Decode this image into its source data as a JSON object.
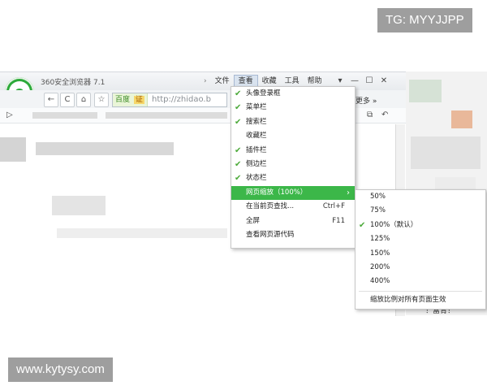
{
  "watermarks": {
    "top_right": "TG: MYYJJPP",
    "bottom_left": "www.kytysy.com"
  },
  "window": {
    "title": "360安全浏览器 7.1",
    "menu": {
      "arrow": "›",
      "items": [
        "文件",
        "查看",
        "收藏",
        "工具",
        "帮助"
      ],
      "active": "查看"
    },
    "window_buttons": [
      "▾",
      "—",
      "☐",
      "✕"
    ]
  },
  "toolbar": {
    "back": "←",
    "refresh": "C",
    "home": "⌂",
    "favorite": "☆",
    "address": {
      "engine_tag": "百度",
      "engine_badge": "证",
      "url": "http://zhidao.b"
    },
    "more_label": "更多 »"
  },
  "view_menu": {
    "items": [
      {
        "label": "头像登录框",
        "checked": true
      },
      {
        "label": "菜单栏",
        "checked": true
      },
      {
        "label": "搜索栏",
        "checked": true
      },
      {
        "label": "收藏栏",
        "checked": false
      },
      {
        "label": "插件栏",
        "checked": true
      },
      {
        "label": "侧边栏",
        "checked": true
      },
      {
        "label": "状态栏",
        "checked": true
      },
      {
        "label": "网页缩放（100%）",
        "checked": false,
        "submenu": true,
        "highlighted": true
      },
      {
        "label": "在当前页查找...",
        "shortcut": "Ctrl+F"
      },
      {
        "label": "全屏",
        "shortcut": "F11"
      },
      {
        "label": "查看网页源代码"
      }
    ]
  },
  "zoom_submenu": {
    "items": [
      {
        "label": "50%",
        "checked": false
      },
      {
        "label": "75%",
        "checked": false
      },
      {
        "label": "100%（默认）",
        "checked": true
      },
      {
        "label": "125%",
        "checked": false
      },
      {
        "label": "150%",
        "checked": false
      },
      {
        "label": "200%",
        "checked": false
      },
      {
        "label": "400%",
        "checked": false
      }
    ],
    "footer": "缩放比例对所有页面生效"
  },
  "page_fragment": "！富青！",
  "colors": {
    "accent": "#3cb749",
    "check": "#4caa3a",
    "logo": "#2daa3a"
  }
}
